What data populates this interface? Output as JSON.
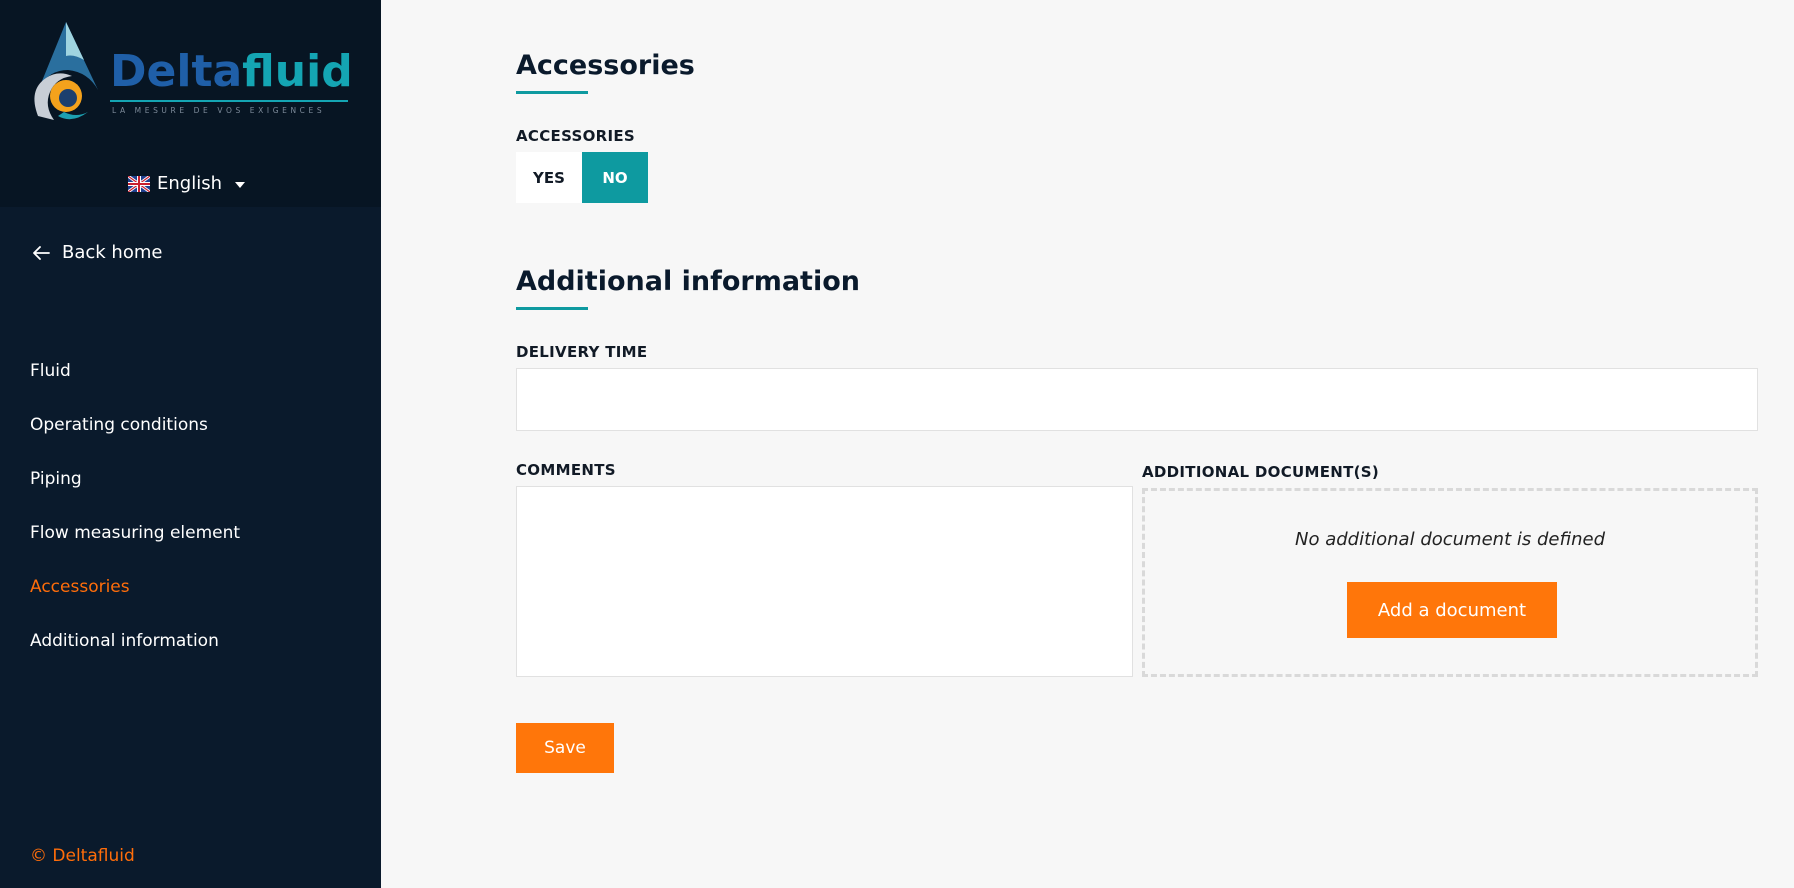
{
  "sidebar": {
    "logo": {
      "word_delta": "Delta",
      "word_fluid": "fluid",
      "tagline": "LA MESURE DE VOS EXIGENCES"
    },
    "language": {
      "label": "English",
      "flag_icon": "uk-flag-icon"
    },
    "back_home": "Back home",
    "nav_items": [
      {
        "label": "Fluid"
      },
      {
        "label": "Operating conditions"
      },
      {
        "label": "Piping"
      },
      {
        "label": "Flow measuring element"
      },
      {
        "label": "Accessories",
        "active": true
      },
      {
        "label": "Additional information"
      }
    ],
    "copyright": "© Deltafluid"
  },
  "accessories_section": {
    "title": "Accessories",
    "field_label": "ACCESSORIES",
    "options": [
      "YES",
      "NO"
    ],
    "selected": "NO"
  },
  "additional_section": {
    "title": "Additional information",
    "delivery_time": {
      "label": "DELIVERY TIME",
      "value": "",
      "placeholder": ""
    },
    "comments": {
      "label": "COMMENTS",
      "value": "",
      "placeholder": ""
    },
    "documents": {
      "label": "ADDITIONAL DOCUMENT(S)",
      "empty_text": "No additional document is defined",
      "add_label": "Add a document"
    }
  },
  "save_label": "Save",
  "colors": {
    "sidebar_bg": "#0a1a2c",
    "accent_teal": "#0e9aa0",
    "accent_orange": "#ff760a",
    "page_bg": "#f7f7f7"
  }
}
